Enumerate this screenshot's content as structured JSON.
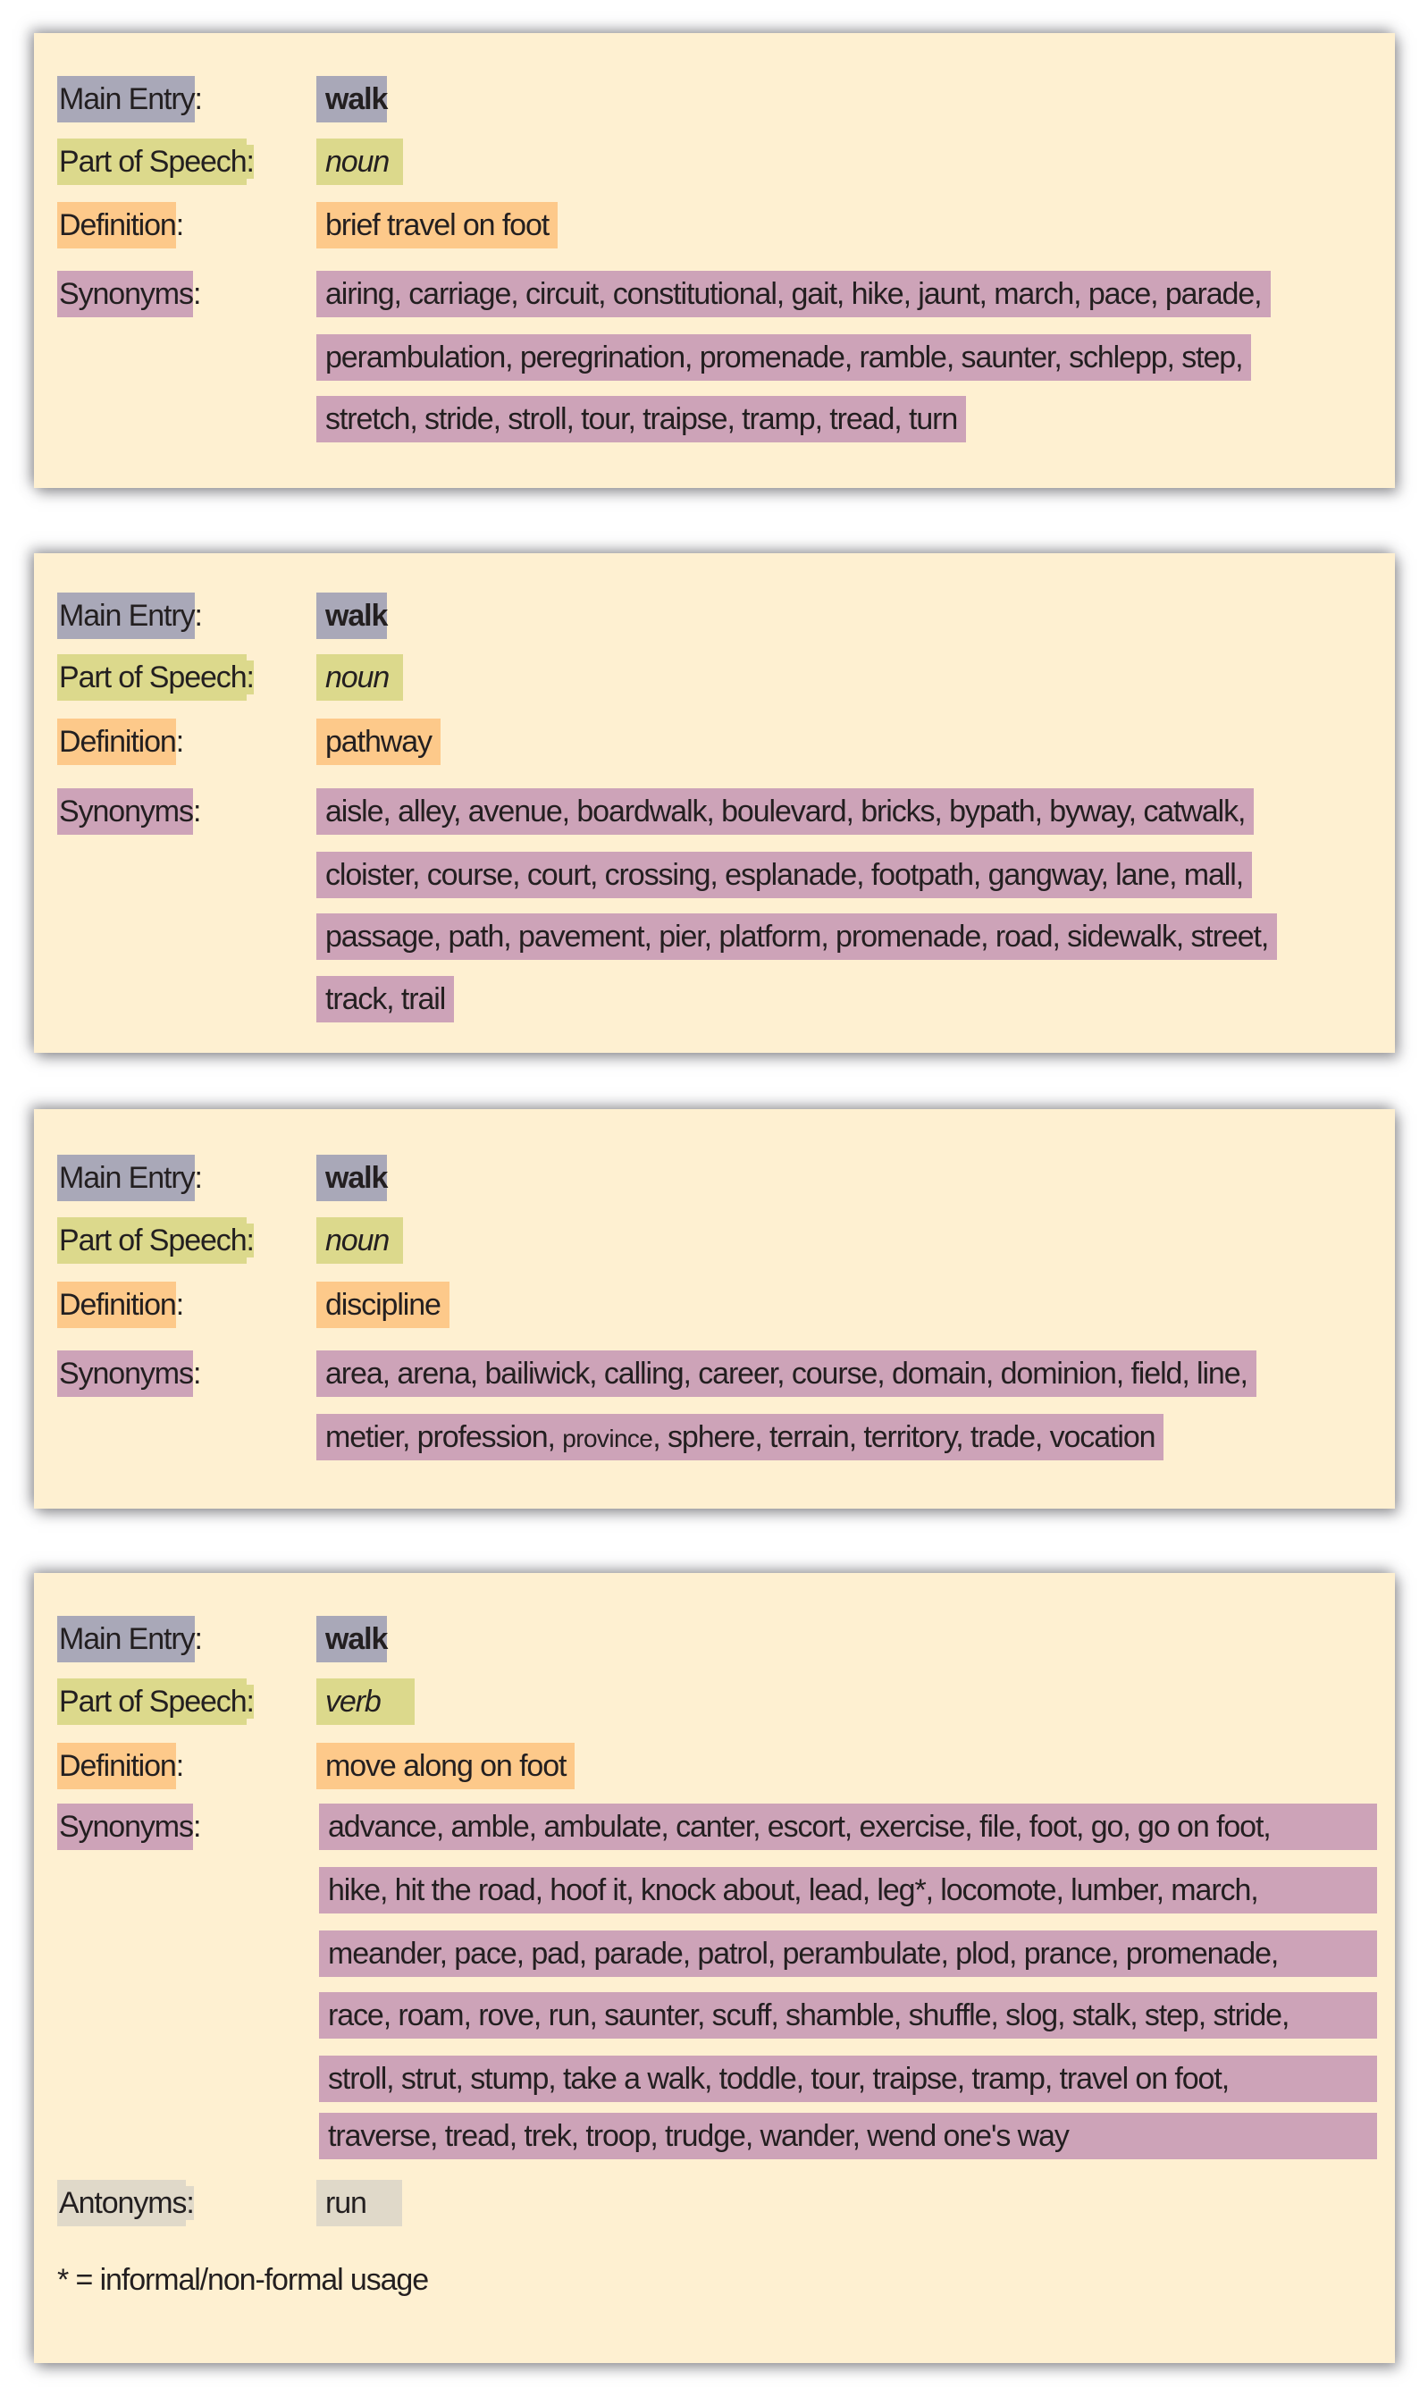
{
  "labels": {
    "main_entry": "Main Entry",
    "part_of_speech": "Part of Speech",
    "definition": "Definition",
    "synonyms": "Synonyms",
    "antonyms": "Antonyms",
    "colon": ":"
  },
  "colors": {
    "card_background": "#fef0d1",
    "main_entry": "#a9a8b8",
    "part_of_speech": "#dcd98c",
    "definition": "#fdc98a",
    "synonyms": "#cda3b8",
    "antonyms": "#e0d9c9"
  },
  "entries": [
    {
      "main_entry": "walk",
      "part_of_speech": "noun",
      "definition": "brief travel on foot",
      "synonym_lines": [
        "airing, carriage, circuit, constitutional, gait, hike, jaunt, march, pace, parade,",
        "perambulation, peregrination, promenade, ramble, saunter, schlepp, step,",
        "stretch, stride, stroll, tour, traipse, tramp, tread, turn"
      ]
    },
    {
      "main_entry": "walk",
      "part_of_speech": "noun",
      "definition": "pathway",
      "synonym_lines": [
        "aisle, alley, avenue, boardwalk, boulevard, bricks, bypath, byway, catwalk,",
        "cloister, course, court, crossing, esplanade, footpath, gangway, lane, mall,",
        "passage, path, pavement, pier, platform, promenade, road, sidewalk, street,",
        "track, trail"
      ]
    },
    {
      "main_entry": "walk",
      "part_of_speech": "noun",
      "definition": "discipline",
      "synonym_lines": [
        "area, arena, bailiwick, calling, career, course, domain, dominion, field, line,"
      ],
      "synonym_line_2": {
        "before": "metier, profession, ",
        "small": "province",
        "after": ", sphere, terrain, territory, trade, vocation"
      }
    },
    {
      "main_entry": "walk",
      "part_of_speech": "verb",
      "definition": "move along on foot",
      "synonym_lines": [
        "advance, amble, ambulate, canter, escort, exercise, file, foot, go, go on foot,",
        "hike, hit the road, hoof it, knock about, lead, leg*, locomote, lumber, march,",
        "meander, pace, pad, parade, patrol, perambulate, plod, prance, promenade,",
        "race, roam, rove, run, saunter, scuff, shamble, shuffle, slog, stalk, step, stride,",
        "stroll, strut, stump, take a walk, toddle, tour, traipse, tramp, travel on foot,",
        "traverse, tread, trek, troop, trudge, wander, wend one's way"
      ],
      "antonyms": "run",
      "footnote": "* = informal/non-formal usage"
    }
  ]
}
